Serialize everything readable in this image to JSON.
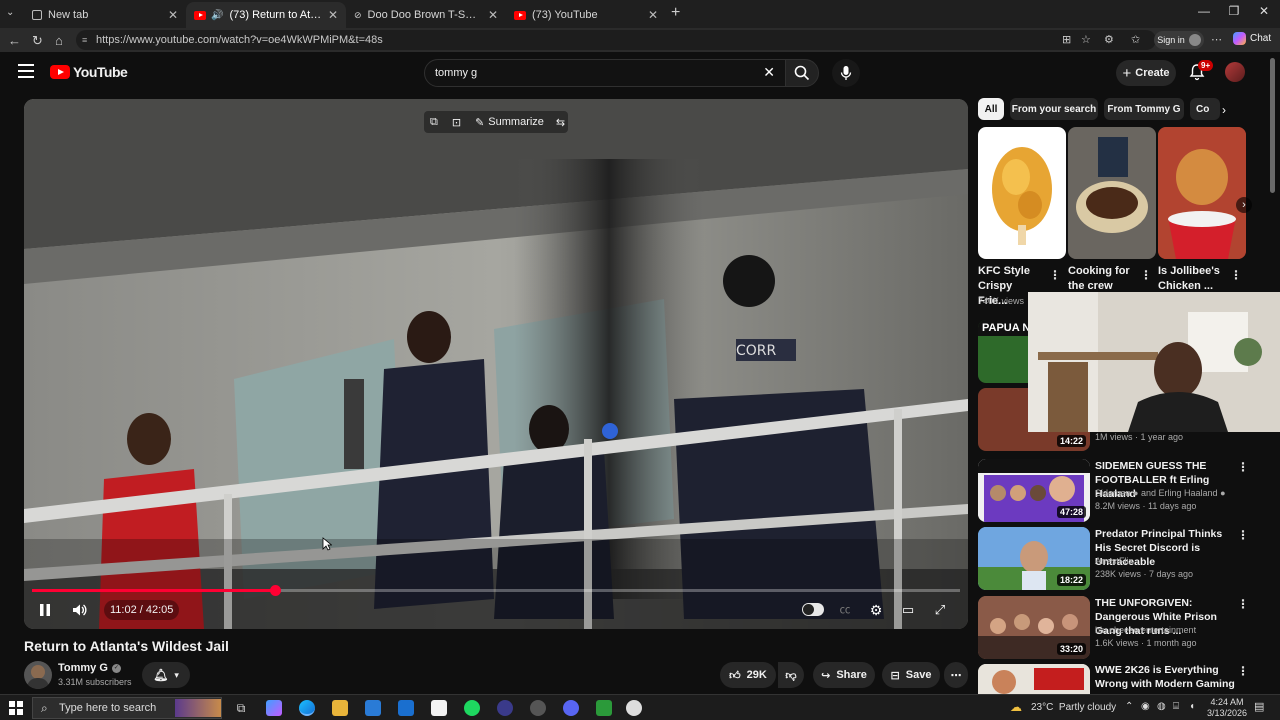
{
  "browser": {
    "tabs": [
      {
        "title": "New tab",
        "active": false
      },
      {
        "title": "(73) Return to Atlanta's Wilde",
        "active": true
      },
      {
        "title": "Doo Doo Brown T-Shirt (PRE-ORD",
        "active": false
      },
      {
        "title": "(73) YouTube",
        "active": false
      }
    ],
    "url": "https://www.youtube.com/watch?v=oe4WkWPMiPM&t=48s",
    "signin_label": "Sign in",
    "chat_label": "Chat"
  },
  "header": {
    "logo_text": "YouTube",
    "search_value": "tommy g",
    "create_label": "Create",
    "notif_count": "9+"
  },
  "player": {
    "overlay_summarize": "Summarize",
    "time_current": "11:02",
    "time_total": "42:05",
    "time_sep": " / ",
    "progress_fraction": 0.262
  },
  "video": {
    "title": "Return to Atlanta's Wildest Jail",
    "channel": "Tommy G",
    "subscribers": "3.31M subscribers",
    "likes": "29K",
    "share_label": "Share",
    "save_label": "Save"
  },
  "sidebar": {
    "chips": [
      "All",
      "From your search",
      "From Tommy G",
      "Co"
    ],
    "shorts": [
      {
        "title": "KFC Style Crispy Frie...",
        "views": "740K views"
      },
      {
        "title": "Cooking for the crew",
        "views": ""
      },
      {
        "title": "Is Jollibee's Chicken ...",
        "views": ""
      }
    ],
    "partial": {
      "thumb_text": "PAPUA N",
      "duration": "14:22",
      "meta": "1M views · 1 year ago"
    },
    "recommendations": [
      {
        "title": "SIDEMEN GUESS THE FOOTBALLER ft Erling Haaland",
        "channel": "Sidemen",
        "channel_extra": "and Erling Haaland",
        "meta": "8.2M views · 11 days ago",
        "duration": "47:28"
      },
      {
        "title": "Predator Principal Thinks His Secret Discord is Untraceable",
        "channel": "ArrestFlix",
        "channel_extra": "",
        "meta": "238K views · 7 days ago",
        "duration": "18:22"
      },
      {
        "title": "THE UNFORGIVEN: Dangerous White Prison Gang that runs ...",
        "channel": "blu cheese entertainment",
        "channel_extra": "",
        "meta": "1.6K views · 1 month ago",
        "duration": "33:20"
      },
      {
        "title": "WWE 2K26 is Everything Wrong with Modern Gaming",
        "channel": "",
        "channel_extra": "",
        "meta": "",
        "duration": ""
      }
    ]
  },
  "taskbar": {
    "search_placeholder": "Type here to search",
    "weather": "23°C  Partly cloudy",
    "time": "4:24 AM",
    "date": "3/13/2026"
  },
  "colors": {
    "accent_red": "#ff0033",
    "bg": "#0f0f0f"
  }
}
